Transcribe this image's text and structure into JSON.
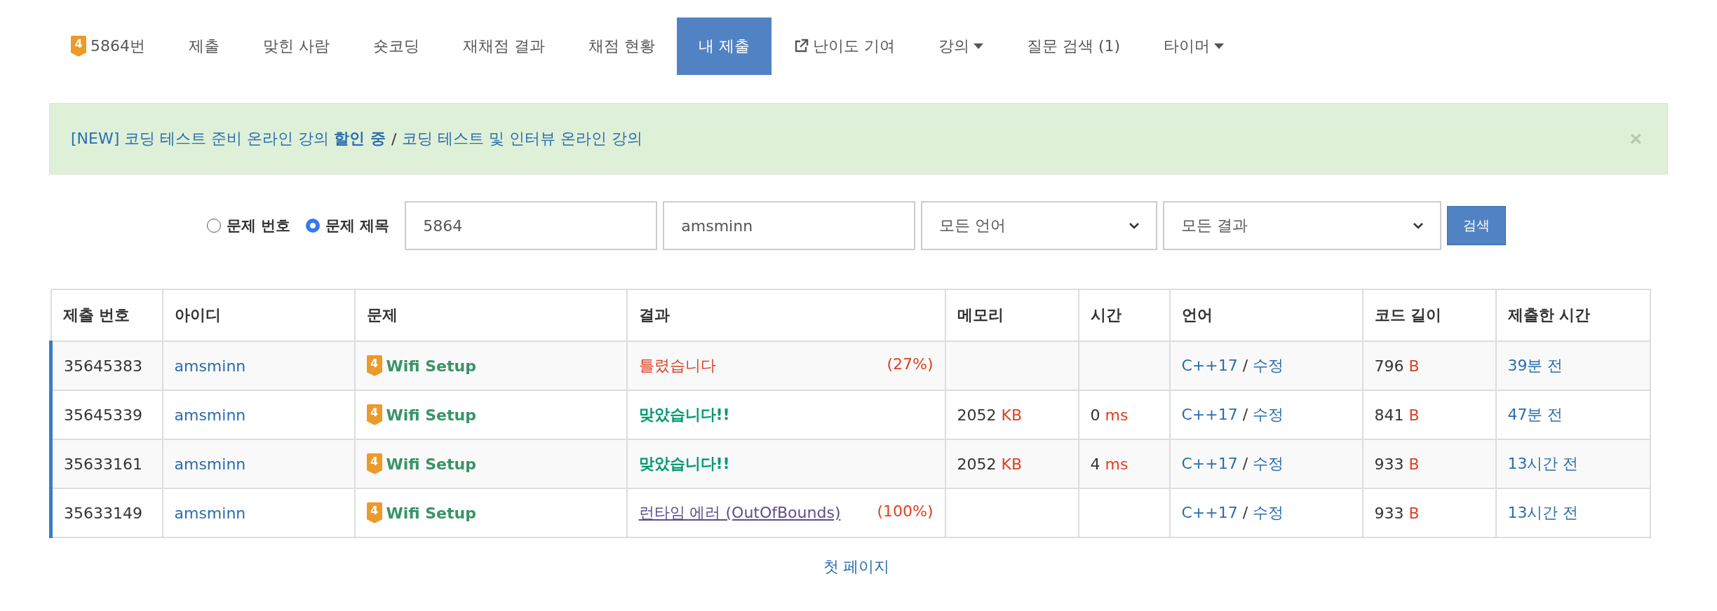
{
  "nav": [
    {
      "kind": "problem",
      "tier": "4",
      "label": "5864번",
      "selected": false
    },
    {
      "kind": "plain",
      "label": "제출",
      "selected": false
    },
    {
      "kind": "plain",
      "label": "맞힌 사람",
      "selected": false
    },
    {
      "kind": "plain",
      "label": "숏코딩",
      "selected": false
    },
    {
      "kind": "plain",
      "label": "재채점 결과",
      "selected": false
    },
    {
      "kind": "plain",
      "label": "채점 현황",
      "selected": false
    },
    {
      "kind": "plain",
      "label": "내 제출",
      "selected": true
    },
    {
      "kind": "external",
      "label": "난이도 기여",
      "selected": false
    },
    {
      "kind": "dropdown",
      "label": "강의",
      "selected": false
    },
    {
      "kind": "plain",
      "label": "질문 검색 (1)",
      "selected": false
    },
    {
      "kind": "dropdown",
      "label": "타이머",
      "selected": false
    }
  ],
  "alert": {
    "link_1": "[NEW] 코딩 테스트 준비 온라인 강의 **할인 중**",
    "separator": "/",
    "link_2": "코딩 테스트 및 인터뷰 온라인 강의",
    "close": "×"
  },
  "search": {
    "radios": [
      {
        "label": "문제 번호",
        "selected": false
      },
      {
        "label": "문제 제목",
        "selected": true
      }
    ],
    "problem_field": "5864",
    "user_field": "amsminn",
    "language_select": "모든 언어",
    "result_select": "모든 결과",
    "button": "검색"
  },
  "table": {
    "columns": [
      "제출 번호",
      "아이디",
      "문제",
      "결과",
      "메모리",
      "시간",
      "언어",
      "코드 길이",
      "제출한 시간"
    ],
    "rows": [
      {
        "id": "35645383",
        "user": "amsminn",
        "tier": "4",
        "problem": "Wifi Setup",
        "kind": "wrong",
        "result": "틀렸습니다",
        "percent": "(27%)",
        "language": "C++17",
        "separator": "/",
        "edit": "수정",
        "code_length": "796",
        "code_unit": "B",
        "submitted": "39분 전"
      },
      {
        "id": "35645339",
        "user": "amsminn",
        "tier": "4",
        "problem": "Wifi Setup",
        "kind": "accepted",
        "result": "맞았습니다!!",
        "memory": "2052",
        "memory_unit": "KB",
        "time": "0",
        "time_unit": "ms",
        "language": "C++17",
        "separator": "/",
        "edit": "수정",
        "code_length": "841",
        "code_unit": "B",
        "submitted": "47분 전"
      },
      {
        "id": "35633161",
        "user": "amsminn",
        "tier": "4",
        "problem": "Wifi Setup",
        "kind": "accepted",
        "result": "맞았습니다!!",
        "memory": "2052",
        "memory_unit": "KB",
        "time": "4",
        "time_unit": "ms",
        "language": "C++17",
        "separator": "/",
        "edit": "수정",
        "code_length": "933",
        "code_unit": "B",
        "submitted": "13시간 전"
      },
      {
        "id": "35633149",
        "user": "amsminn",
        "tier": "4",
        "problem": "Wifi Setup",
        "kind": "runtime_error",
        "result": "런타임 에러 (OutOfBounds)",
        "percent": "(100%)",
        "language": "C++17",
        "separator": "/",
        "edit": "수정",
        "code_length": "933",
        "code_unit": "B",
        "submitted": "13시간 전"
      }
    ]
  },
  "pagination": {
    "first_page": "첫 페이지"
  }
}
